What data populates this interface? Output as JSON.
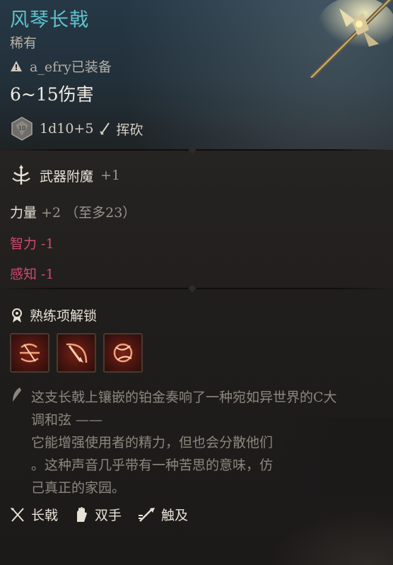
{
  "item": {
    "name": "风琴长戟",
    "rarity": "稀有",
    "equipped_by": "a_efry已装备",
    "damage": "6~15伤害",
    "damage_roll": "1d10+5",
    "damage_type": "挥砍"
  },
  "enchant": {
    "label": "武器附魔",
    "value": "+1"
  },
  "stats": {
    "strength_label": "力量",
    "strength_value": "+2",
    "strength_note": "（至多23）",
    "intelligence": "智力 -1",
    "wisdom": "感知 -1"
  },
  "proficiency": {
    "label": "熟练项解锁"
  },
  "description": {
    "line1": "这支长戟上镶嵌的铂金奏响了一种宛如异世界的C大",
    "line2": "调和弦 ——",
    "line3": "它能增强使用者的精力，但也会分散他们",
    "line4": "。这种声音几乎带有一种苦思的意味，仿",
    "line5": "己真正的家园。"
  },
  "properties": {
    "weapon_type": "长戟",
    "handedness": "双手",
    "reach": "触及"
  },
  "colors": {
    "title": "#5ec2ce",
    "penalty": "#d14a6f",
    "muted": "#9a958c"
  },
  "icons": [
    "warning-icon",
    "dice-icon",
    "slash-icon",
    "enchant-icon",
    "proficiency-icon",
    "action-icon-1",
    "action-icon-2",
    "action-icon-3",
    "quill-icon",
    "halberd-icon",
    "two-hands-icon",
    "reach-icon",
    "halberd-art"
  ]
}
